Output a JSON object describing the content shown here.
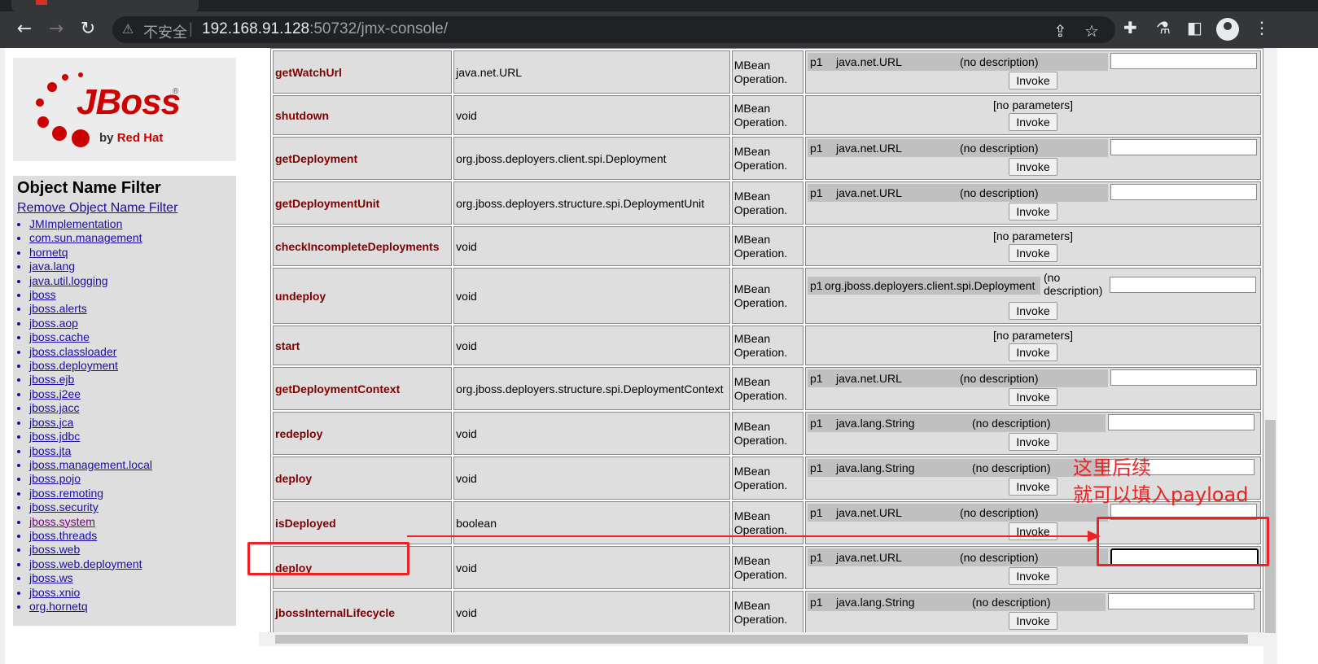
{
  "browser": {
    "security_icon": "warning-triangle-icon",
    "insecure_label": "不安全",
    "url_host": "192.168.91.128",
    "url_rest": ":50732/jmx-console/"
  },
  "sidebar": {
    "filter_title": "Object Name Filter",
    "remove_filter": "Remove Object Name Filter",
    "logo_by": "by",
    "logo_redhat": "Red Hat",
    "domains": [
      "JMImplementation",
      "com.sun.management",
      "hornetq",
      "java.lang",
      "java.util.logging",
      "jboss",
      "jboss.alerts",
      "jboss.aop",
      "jboss.cache",
      "jboss.classloader",
      "jboss.deployment",
      "jboss.ejb",
      "jboss.j2ee",
      "jboss.jacc",
      "jboss.jca",
      "jboss.jdbc",
      "jboss.jta",
      "jboss.management.local",
      "jboss.pojo",
      "jboss.remoting",
      "jboss.security",
      "jboss.system",
      "jboss.threads",
      "jboss.web",
      "jboss.web.deployment",
      "jboss.ws",
      "jboss.xnio",
      "org.hornetq"
    ],
    "visited_domain": "jboss.system"
  },
  "operations": [
    {
      "name": "getWatchUrl",
      "return": "java.net.URL",
      "kind": "MBean Operation.",
      "param": {
        "p": "p1",
        "type": "java.net.URL",
        "desc": "(no description)"
      }
    },
    {
      "name": "shutdown",
      "return": "void",
      "kind": "MBean Operation.",
      "noparams": "[no parameters]"
    },
    {
      "name": "getDeployment",
      "return": "org.jboss.deployers.client.spi.Deployment",
      "kind": "MBean Operation.",
      "param": {
        "p": "p1",
        "type": "java.net.URL",
        "desc": "(no description)"
      }
    },
    {
      "name": "getDeploymentUnit",
      "return": "org.jboss.deployers.structure.spi.DeploymentUnit",
      "kind": "MBean Operation.",
      "param": {
        "p": "p1",
        "type": "java.net.URL",
        "desc": "(no description)"
      }
    },
    {
      "name": "checkIncompleteDeployments",
      "return": "void",
      "kind": "MBean Operation.",
      "noparams": "[no parameters]"
    },
    {
      "name": "undeploy",
      "return": "void",
      "kind": "MBean Operation.",
      "param": {
        "p": "p1",
        "type": "org.jboss.deployers.client.spi.Deployment",
        "desc": "(no description)"
      }
    },
    {
      "name": "start",
      "return": "void",
      "kind": "MBean Operation.",
      "noparams": "[no parameters]"
    },
    {
      "name": "getDeploymentContext",
      "return": "org.jboss.deployers.structure.spi.DeploymentContext",
      "kind": "MBean Operation.",
      "param": {
        "p": "p1",
        "type": "java.net.URL",
        "desc": "(no description)"
      }
    },
    {
      "name": "redeploy",
      "return": "void",
      "kind": "MBean Operation.",
      "param": {
        "p": "p1",
        "type": "java.lang.String",
        "desc": "(no description)"
      }
    },
    {
      "name": "deploy",
      "return": "void",
      "kind": "MBean Operation.",
      "param": {
        "p": "p1",
        "type": "java.lang.String",
        "desc": "(no description)"
      }
    },
    {
      "name": "isDeployed",
      "return": "boolean",
      "kind": "MBean Operation.",
      "param": {
        "p": "p1",
        "type": "java.net.URL",
        "desc": "(no description)"
      }
    },
    {
      "name": "deploy",
      "return": "void",
      "kind": "MBean Operation.",
      "param": {
        "p": "p1",
        "type": "java.net.URL",
        "desc": "(no description)"
      }
    },
    {
      "name": "jbossInternalLifecycle",
      "return": "void",
      "kind": "MBean Operation.",
      "param": {
        "p": "p1",
        "type": "java.lang.String",
        "desc": "(no description)"
      }
    }
  ],
  "invoke_label": "Invoke",
  "annotation": {
    "line1": "这里后续",
    "line2": "就可以填入payload",
    "color": "#ee2222"
  }
}
